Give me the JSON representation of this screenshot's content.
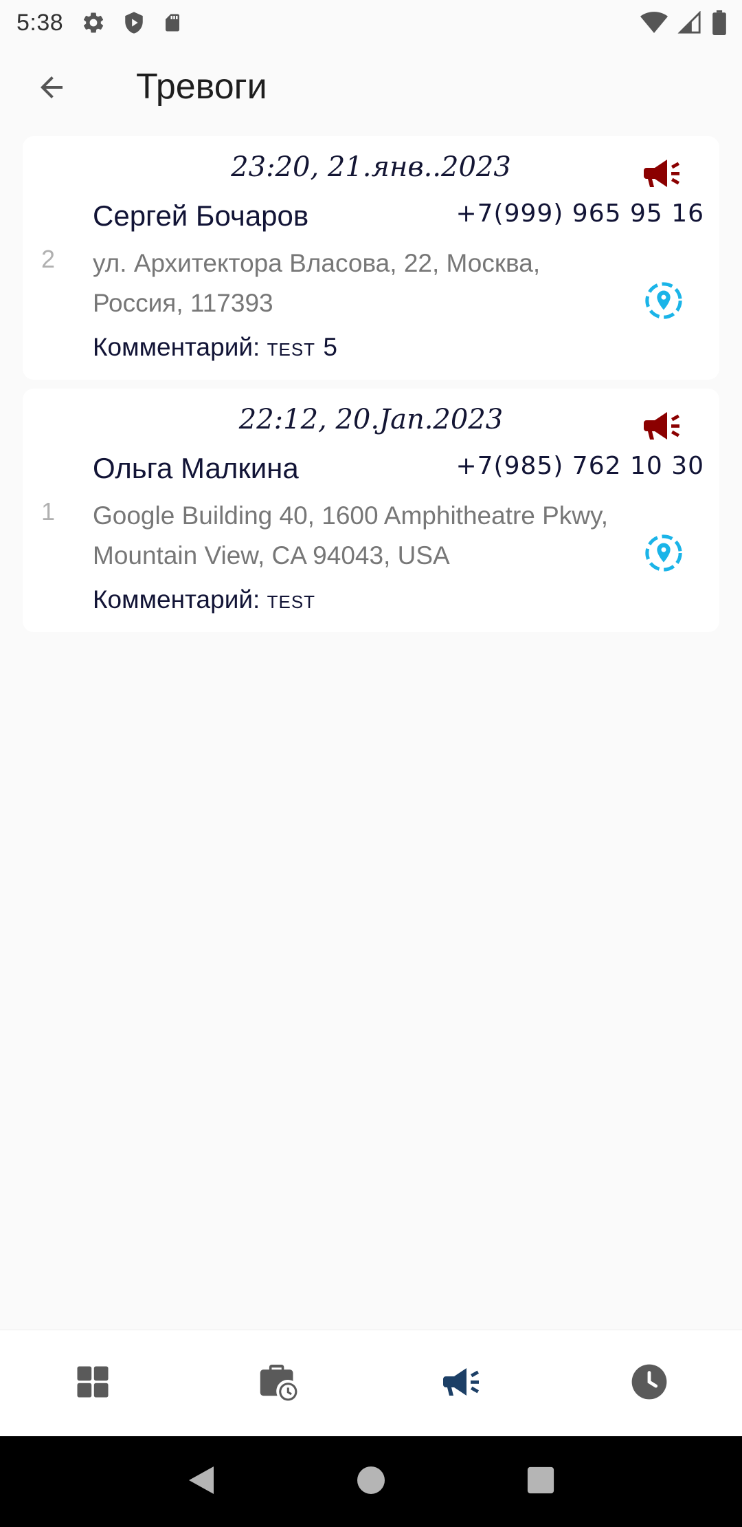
{
  "status_bar": {
    "time": "5:38",
    "icons_left": [
      "gear-icon",
      "shield-icon",
      "sd-card-icon"
    ],
    "icons_right": [
      "wifi-icon",
      "signal-icon",
      "battery-icon"
    ]
  },
  "app_bar": {
    "title": "Тревоги",
    "back_icon": "arrow-back-icon"
  },
  "alarms": [
    {
      "index": "2",
      "datetime": "23:20, 21.янв..2023",
      "name": "Сергей Бочаров",
      "phone": "+7(999) 965 95 16",
      "address": "ул. Архитектора Власова, 22, Москва, Россия, 117393",
      "comment_label": "Комментарий:",
      "comment_value": "test 5"
    },
    {
      "index": "1",
      "datetime": "22:12, 20.Jan.2023",
      "name": "Ольга Малкина",
      "phone": "+7(985) 762 10 30",
      "address": "Google Building 40, 1600 Amphitheatre Pkwy, Mountain View, CA 94043, USA",
      "comment_label": "Комментарий:",
      "comment_value": "test"
    }
  ],
  "bottom_nav": {
    "items": [
      "dashboard-icon",
      "briefcase-clock-icon",
      "megaphone-icon",
      "clock-icon"
    ],
    "active_index": 2
  },
  "colors": {
    "alarm_red": "#8b0000",
    "location_blue": "#1ab4e8",
    "nav_active": "#1c3f66",
    "nav_inactive": "#5a5a5a",
    "text_dark": "#121436"
  }
}
